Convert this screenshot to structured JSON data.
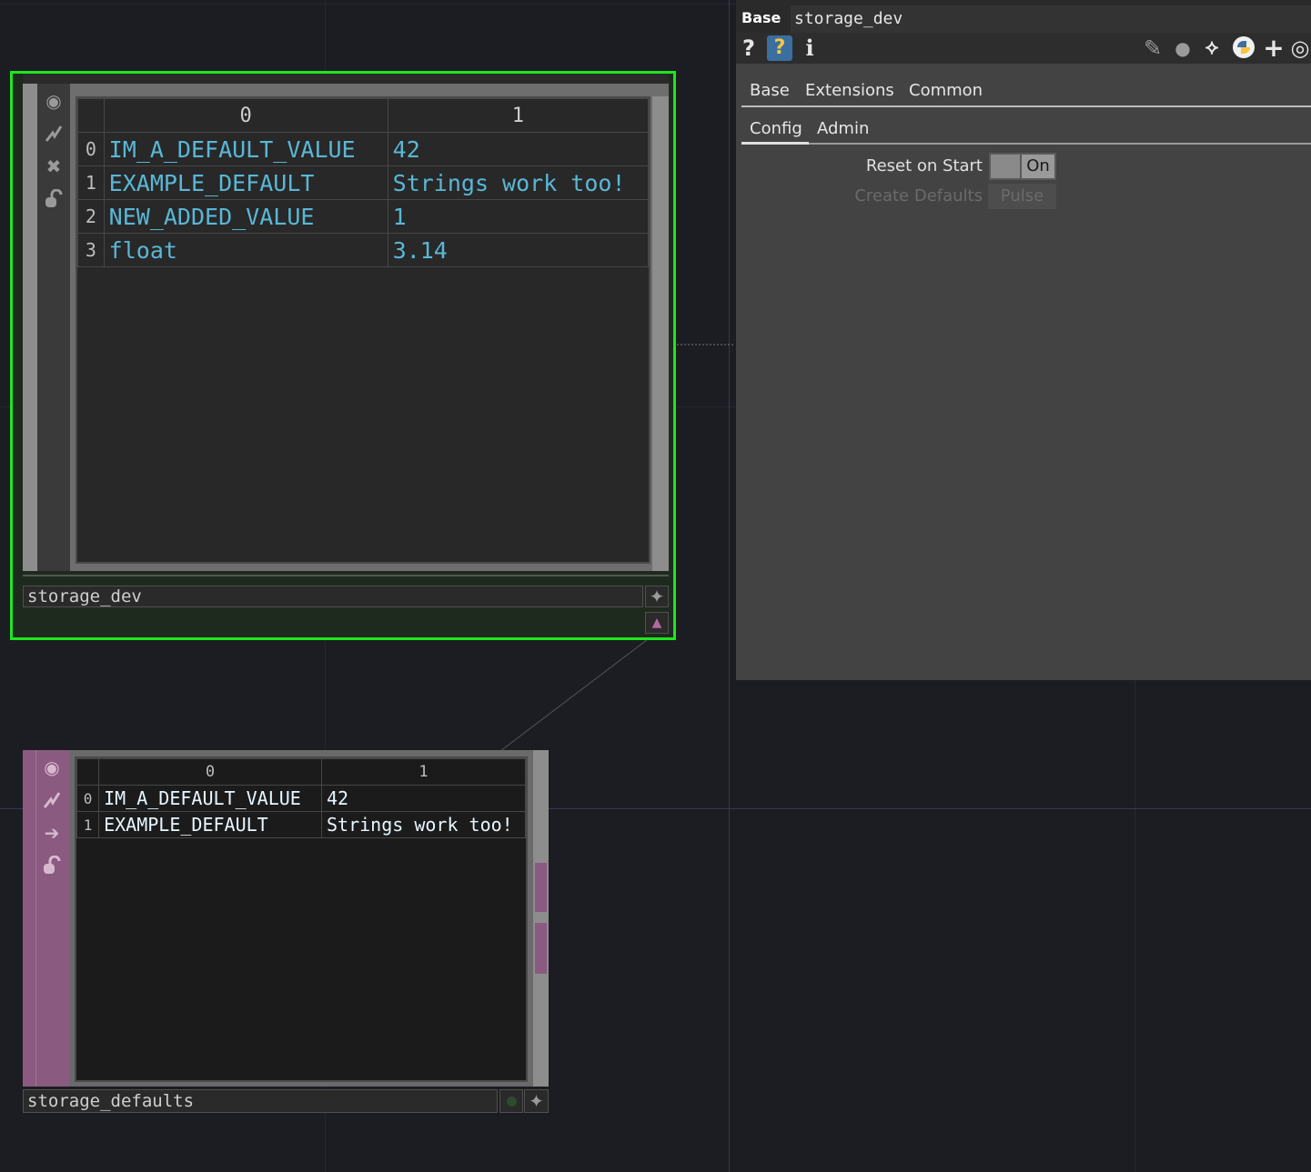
{
  "network": {
    "storage_dev": {
      "name": "storage_dev",
      "sidebar_icons": [
        "viewer-icon",
        "cook-icon",
        "bypass-icon",
        "lock-icon"
      ],
      "table": {
        "headers": [
          "0",
          "1"
        ],
        "rows": [
          {
            "index": "0",
            "key": "IM_A_DEFAULT_VALUE",
            "value": "42"
          },
          {
            "index": "1",
            "key": "EXAMPLE_DEFAULT",
            "value": "Strings work too!"
          },
          {
            "index": "2",
            "key": "NEW_ADDED_VALUE",
            "value": "1"
          },
          {
            "index": "3",
            "key": "float",
            "value": "3.14"
          }
        ]
      },
      "border_color": "#1ee61e"
    },
    "storage_defaults": {
      "name": "storage_defaults",
      "sidebar_icons": [
        "viewer-icon",
        "cook-icon",
        "arrow-right-icon",
        "lock-icon"
      ],
      "table": {
        "headers": [
          "0",
          "1"
        ],
        "rows": [
          {
            "index": "0",
            "key": "IM_A_DEFAULT_VALUE",
            "value": "42"
          },
          {
            "index": "1",
            "key": "EXAMPLE_DEFAULT",
            "value": "Strings work too!"
          }
        ]
      },
      "color": "#8a5a80"
    }
  },
  "panel": {
    "type_label": "Base",
    "op_name": "storage_dev",
    "toolbar_left": [
      "help-icon",
      "python-help-icon",
      "info-icon"
    ],
    "toolbar_right": [
      "edit-icon",
      "comment-icon",
      "clone-icon",
      "python-icon",
      "add-icon",
      "target-icon"
    ],
    "page_tabs": [
      "Base",
      "Extensions",
      "Common"
    ],
    "sub_tabs": [
      "Config",
      "Admin"
    ],
    "active_sub_tab": "Config",
    "params": [
      {
        "label": "Reset on Start",
        "value": "On"
      },
      {
        "label": "Create Defaults",
        "value": "Pulse"
      }
    ]
  }
}
